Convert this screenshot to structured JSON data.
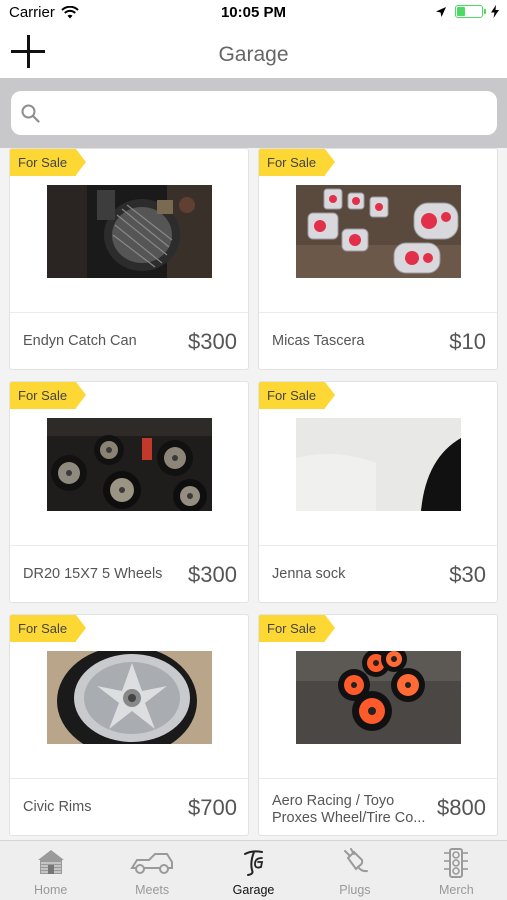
{
  "status_bar": {
    "carrier": "Carrier",
    "time": "10:05 PM",
    "battery_level": 0.35
  },
  "nav": {
    "title": "Garage",
    "add_icon": "plus-icon"
  },
  "search": {
    "placeholder": "",
    "value": "",
    "icon": "search-icon"
  },
  "listings": [
    {
      "badge": "For Sale",
      "title": "Endyn Catch Can",
      "price": "$300"
    },
    {
      "badge": "For Sale",
      "title": "Micas Tascera",
      "price": "$10"
    },
    {
      "badge": "For Sale",
      "title": "DR20 15X7 5 Wheels",
      "price": "$300"
    },
    {
      "badge": "For Sale",
      "title": "Jenna sock",
      "price": "$30"
    },
    {
      "badge": "For Sale",
      "title": "Civic Rims",
      "price": "$700"
    },
    {
      "badge": "For Sale",
      "title_line1": "Aero Racing / Toyo",
      "title_line2": "Proxes Wheel/Tire Co...",
      "price": "$800"
    }
  ],
  "tabs": [
    {
      "label": "Home",
      "icon": "home-icon"
    },
    {
      "label": "Meets",
      "icon": "car-icon"
    },
    {
      "label": "Garage",
      "icon": "garage-logo-icon",
      "active": true
    },
    {
      "label": "Plugs",
      "icon": "plug-icon"
    },
    {
      "label": "Merch",
      "icon": "traffic-light-icon"
    }
  ],
  "colors": {
    "ribbon": "#fdd835",
    "search_bg": "#c8c8cb",
    "battery": "#4cd964",
    "tab_bar": "#eeeeee"
  }
}
